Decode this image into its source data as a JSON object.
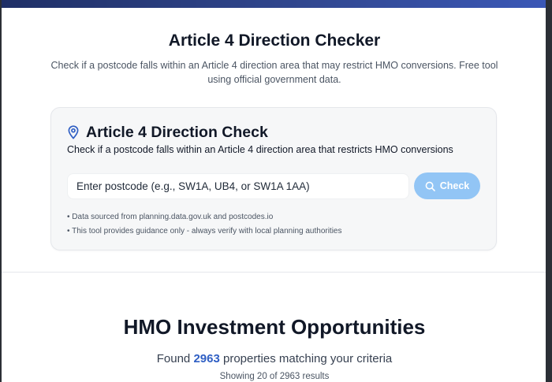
{
  "hero": {
    "title": "Article 4 Direction Checker",
    "subtitle": "Check if a postcode falls within an Article 4 direction area that may restrict HMO conversions. Free tool using official government data."
  },
  "card": {
    "icon": "map-pin-icon",
    "title": "Article 4 Direction Check",
    "subtitle": "Check if a postcode falls within an Article 4 direction area that restricts HMO conversions",
    "input": {
      "value": "",
      "placeholder": "Enter postcode (e.g., SW1A, UB4, or SW1A 1AA)"
    },
    "check_button": {
      "label": "Check",
      "icon": "search-icon",
      "color": "#92c5f5"
    },
    "notes": [
      "• Data sourced from planning.data.gov.uk and postcodes.io",
      "• This tool provides guidance only - always verify with local planning authorities"
    ]
  },
  "results": {
    "title": "HMO Investment Opportunities",
    "found_prefix": "Found",
    "found_count": "2963",
    "found_suffix": "properties matching your criteria",
    "showing": "Showing 20 of 2963 results"
  },
  "colors": {
    "accent": "#2f5fc4",
    "header_gradient_start": "#1f2f66",
    "header_gradient_end": "#3a57b6"
  }
}
